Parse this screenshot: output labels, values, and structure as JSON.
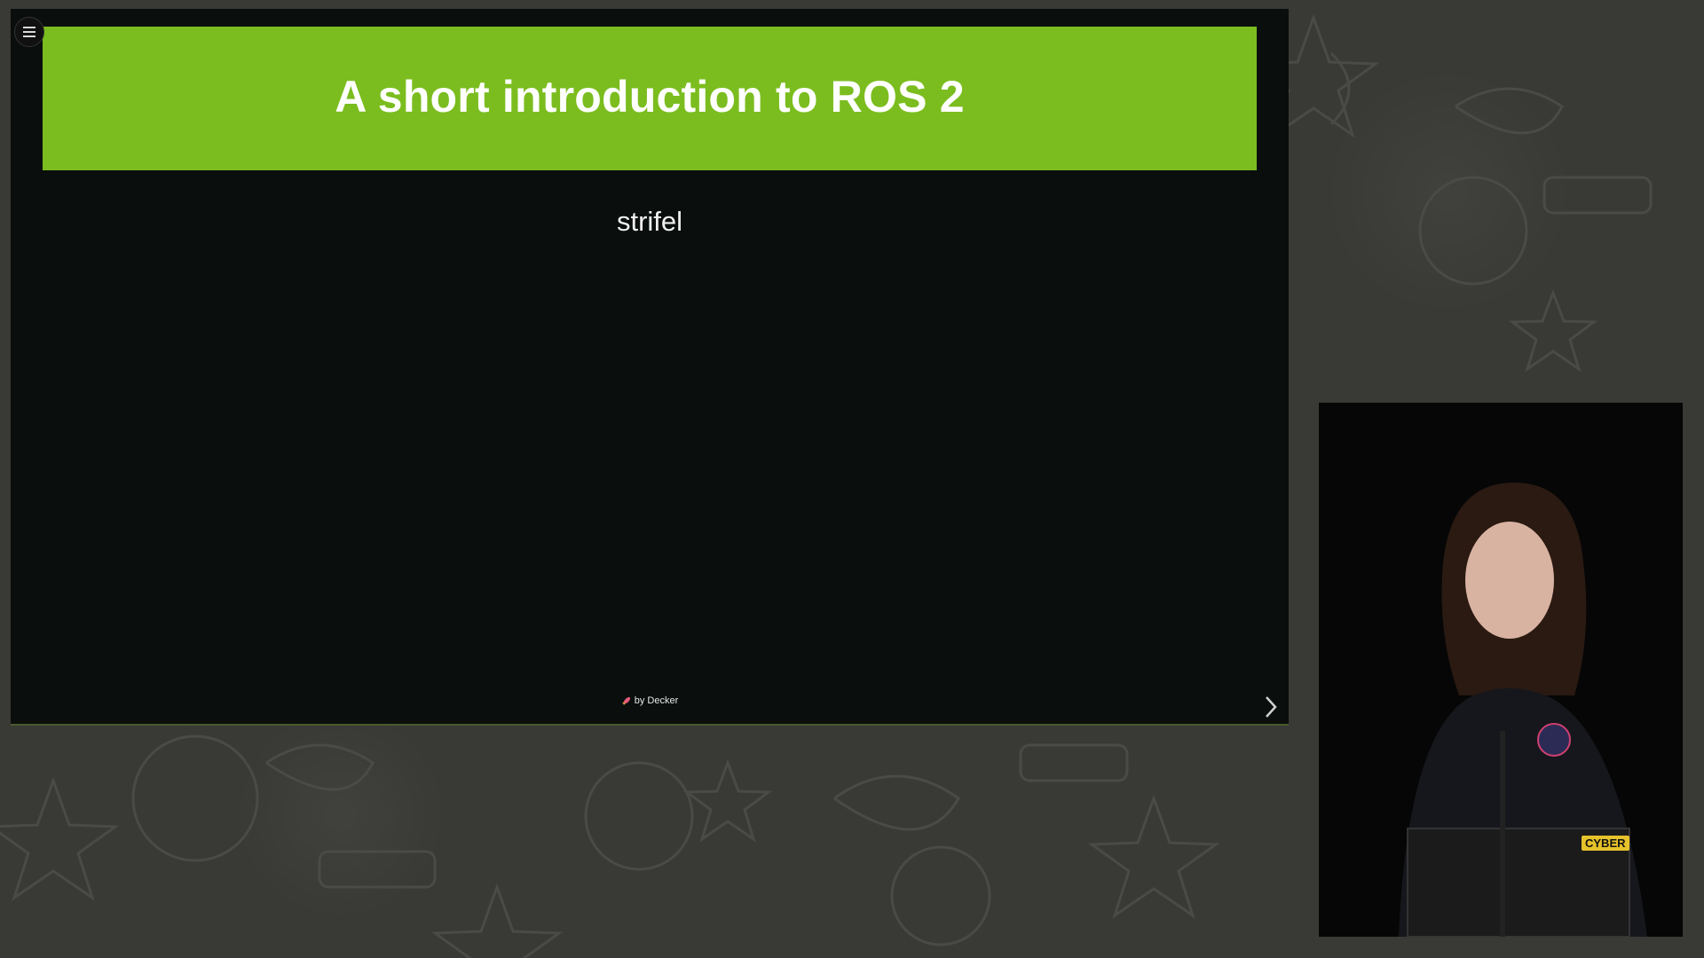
{
  "slide": {
    "title": "A short introduction to ROS 2",
    "author": "strifel",
    "footer_text": "by Decker",
    "banner_color": "#7bbd1f",
    "background_color": "#0a0f0e"
  },
  "controls": {
    "menu_icon": "hamburger-menu-icon",
    "next_icon": "chevron-right-icon",
    "footer_icon": "rocket-icon"
  },
  "speaker_feed": {
    "laptop_sticker": "CYBER"
  }
}
